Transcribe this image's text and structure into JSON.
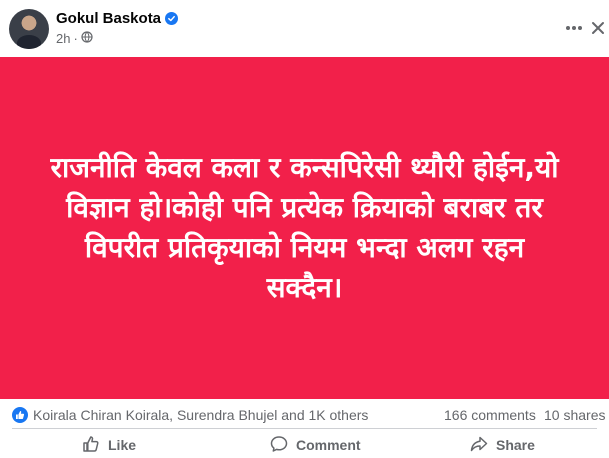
{
  "post": {
    "author": "Gokul Baskota",
    "time": "2h",
    "icons": {
      "verified": "verified-badge-icon",
      "audience": "globe-icon",
      "more": "more-dots-icon",
      "close": "close-icon"
    },
    "content_lines": [
      "राजनीति केवल कला र कन्सपिरेसी थ्यौरी होईन,यो",
      "विज्ञान हो।कोही पनि प्रत्येक क्रियाको बराबर तर",
      "विपरीत प्रतिकृयाको नियम भन्दा अलग रहन",
      "सक्दैन।"
    ],
    "background_color": "#f2204a",
    "text_color": "#ffffff"
  },
  "stats": {
    "reactors": "Koirala Chiran Koirala, Surendra Bhujel and 1K others",
    "comments": "166 comments",
    "shares": "10 shares",
    "reaction_icon": "like-reaction-icon"
  },
  "actions": {
    "like": "Like",
    "comment": "Comment",
    "share": "Share"
  },
  "colors": {
    "accent": "#1877f2",
    "muted": "#65676b"
  }
}
